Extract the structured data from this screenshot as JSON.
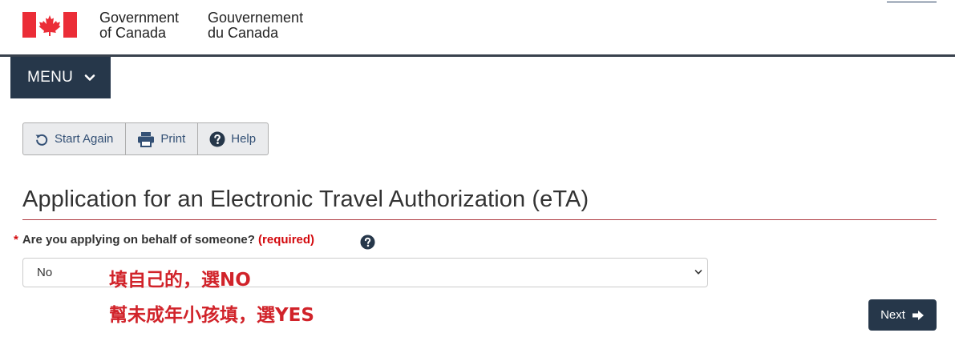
{
  "header": {
    "gov_en_line1": "Government",
    "gov_en_line2": "of Canada",
    "gov_fr_line1": "Gouvernement",
    "gov_fr_line2": "du Canada",
    "flag_red": "#eb2d37"
  },
  "menu": {
    "label": "MENU"
  },
  "toolbar": {
    "start_again": "Start Again",
    "print": "Print",
    "help": "Help"
  },
  "page": {
    "title": "Application for an Electronic Travel Authorization (eTA)"
  },
  "question": {
    "required_marker": "*",
    "label": "Are you applying on behalf of someone?",
    "required_text": "(required)",
    "selected_value": "No"
  },
  "annotations": {
    "note1": "填自己的，選NO",
    "note2": "幫未成年小孩填，選YES"
  },
  "next_button": {
    "label": "Next"
  },
  "colors": {
    "nav_dark": "#26374a",
    "required_red": "#d3080c",
    "annotation_red": "#d1232a"
  }
}
